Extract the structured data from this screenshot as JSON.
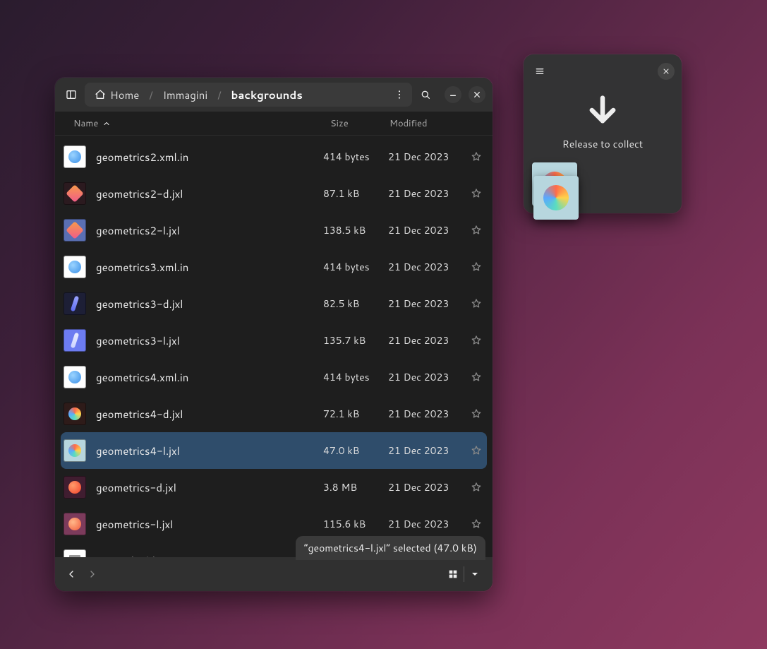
{
  "fm": {
    "breadcrumbs": [
      {
        "label": "Home",
        "is_home": true
      },
      {
        "label": "Immagini"
      },
      {
        "label": "backgrounds",
        "current": true
      }
    ],
    "columns": {
      "name": "Name",
      "size": "Size",
      "modified": "Modified",
      "sort_asc": true
    },
    "files": [
      {
        "name": "geometrics2.xml.in",
        "size": "414 bytes",
        "modified": "21 Dec 2023",
        "icon": "xml",
        "starred": false,
        "selected": false
      },
      {
        "name": "geometrics2-d.jxl",
        "size": "87.1 kB",
        "modified": "21 Dec 2023",
        "icon": "dark",
        "starred": false,
        "selected": false
      },
      {
        "name": "geometrics2-l.jxl",
        "size": "138.5 kB",
        "modified": "21 Dec 2023",
        "icon": "light",
        "starred": false,
        "selected": false
      },
      {
        "name": "geometrics3.xml.in",
        "size": "414 bytes",
        "modified": "21 Dec 2023",
        "icon": "xml",
        "starred": false,
        "selected": false
      },
      {
        "name": "geometrics3-d.jxl",
        "size": "82.5 kB",
        "modified": "21 Dec 2023",
        "icon": "d3",
        "starred": false,
        "selected": false
      },
      {
        "name": "geometrics3-l.jxl",
        "size": "135.7 kB",
        "modified": "21 Dec 2023",
        "icon": "l3",
        "starred": false,
        "selected": false
      },
      {
        "name": "geometrics4.xml.in",
        "size": "414 bytes",
        "modified": "21 Dec 2023",
        "icon": "xml",
        "starred": false,
        "selected": false
      },
      {
        "name": "geometrics4-d.jxl",
        "size": "72.1 kB",
        "modified": "21 Dec 2023",
        "icon": "d4",
        "starred": false,
        "selected": false
      },
      {
        "name": "geometrics4-l.jxl",
        "size": "47.0 kB",
        "modified": "21 Dec 2023",
        "icon": "l4",
        "starred": false,
        "selected": true
      },
      {
        "name": "geometrics-d.jxl",
        "size": "3.8 MB",
        "modified": "21 Dec 2023",
        "icon": "bigd",
        "starred": false,
        "selected": false
      },
      {
        "name": "geometrics-l.jxl",
        "size": "115.6 kB",
        "modified": "21 Dec 2023",
        "icon": "bigl",
        "starred": false,
        "selected": false
      },
      {
        "name": "meson.build",
        "size": "",
        "modified": "",
        "icon": "txt",
        "starred": false,
        "selected": false
      }
    ],
    "status": "“geometrics4-l.jxl” selected  (47.0 kB)"
  },
  "drop": {
    "label": "Release to collect"
  }
}
